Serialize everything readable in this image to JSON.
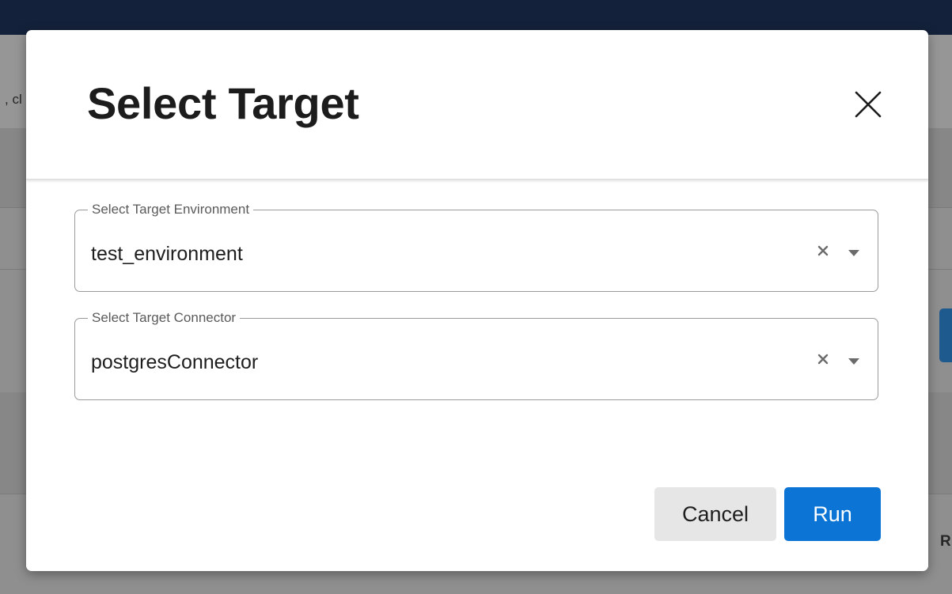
{
  "background": {
    "partial_text_left": ", cl",
    "partial_text_right": "R"
  },
  "modal": {
    "title": "Select Target",
    "close_icon": "close-icon",
    "fields": {
      "environment": {
        "legend": "Select Target Environment",
        "value": "test_environment",
        "clear_icon": "clear-x-icon",
        "dropdown_icon": "caret-down-icon"
      },
      "connector": {
        "legend": "Select Target Connector",
        "value": "postgresConnector",
        "clear_icon": "clear-x-icon",
        "dropdown_icon": "caret-down-icon"
      }
    },
    "buttons": {
      "cancel_label": "Cancel",
      "run_label": "Run"
    }
  },
  "colors": {
    "primary": "#0b74d4",
    "topbar": "#13213a",
    "cancel_bg": "#e6e6e6"
  }
}
